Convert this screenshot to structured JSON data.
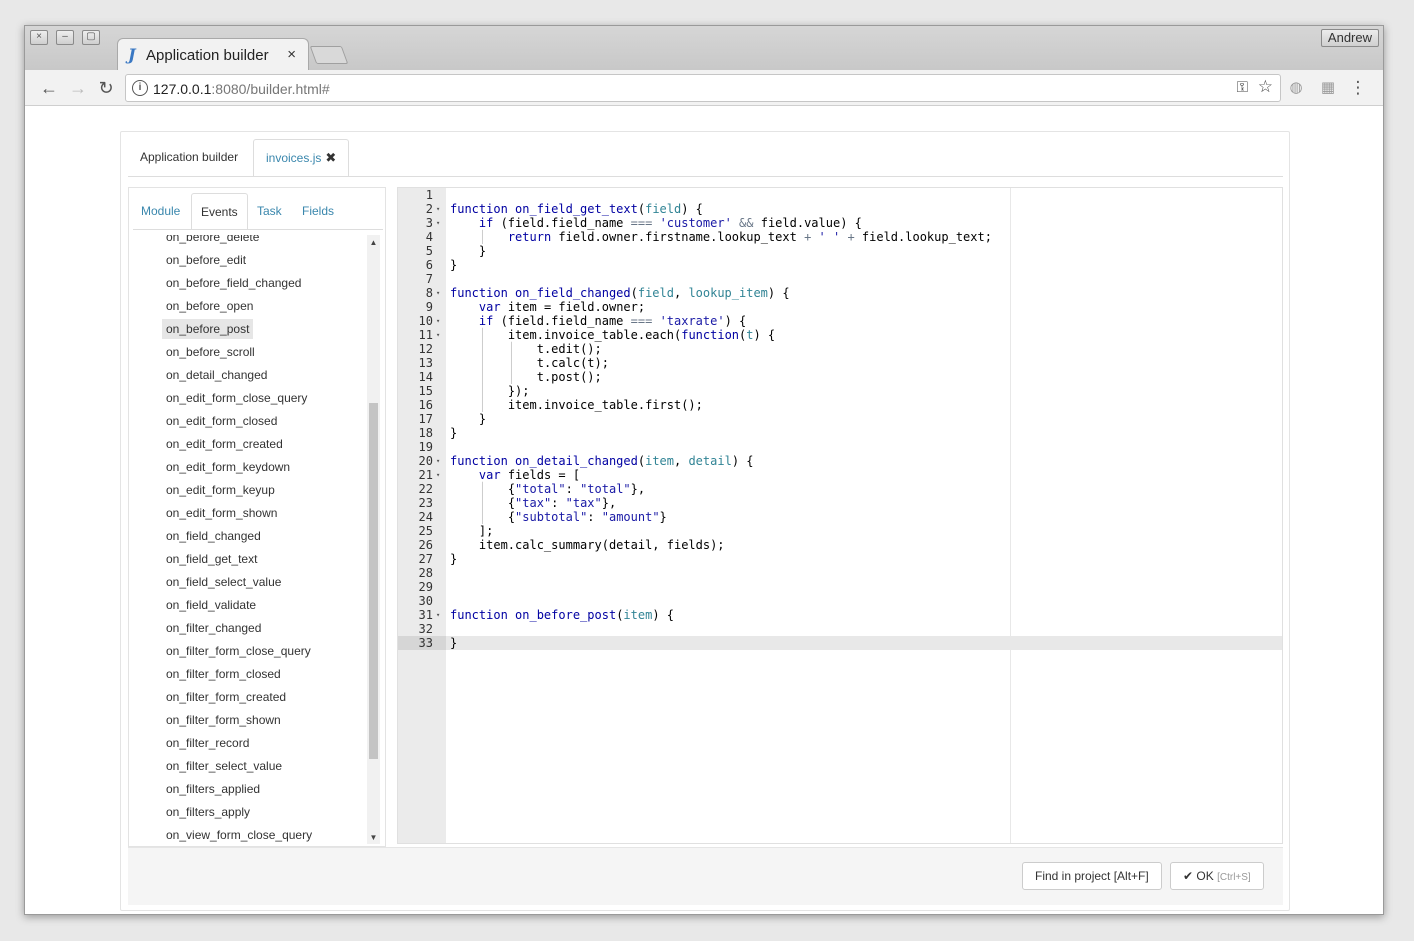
{
  "browser": {
    "tab_title": "Application builder",
    "tab_logo": "J",
    "tab_close": "×",
    "user": "Andrew",
    "window_buttons": [
      "×",
      "–",
      "▢"
    ],
    "url_host": "127.0.0.1",
    "url_rest": ":8080/builder.html#",
    "icons": {
      "back": "←",
      "forward": "→",
      "reload": "↻",
      "info": "i",
      "key": "⚿",
      "star": "☆",
      "globe": "◍",
      "ext": "▦",
      "menu": "⋮"
    }
  },
  "page_tabs": [
    {
      "label": "Application builder"
    },
    {
      "label": "invoices.js",
      "close": "✖"
    }
  ],
  "sub_tabs": [
    "Module",
    "Events",
    "Task",
    "Fields"
  ],
  "events": [
    "on_before_delete",
    "on_before_edit",
    "on_before_field_changed",
    "on_before_open",
    "on_before_post",
    "on_before_scroll",
    "on_detail_changed",
    "on_edit_form_close_query",
    "on_edit_form_closed",
    "on_edit_form_created",
    "on_edit_form_keydown",
    "on_edit_form_keyup",
    "on_edit_form_shown",
    "on_field_changed",
    "on_field_get_text",
    "on_field_select_value",
    "on_field_validate",
    "on_filter_changed",
    "on_filter_form_close_query",
    "on_filter_form_closed",
    "on_filter_form_created",
    "on_filter_form_shown",
    "on_filter_record",
    "on_filter_select_value",
    "on_filters_applied",
    "on_filters_apply",
    "on_view_form_close_query"
  ],
  "selected_event": "on_before_post",
  "scroll_arrows": {
    "up": "▲",
    "down": "▼"
  },
  "fold_marker": "▾",
  "fold_lines": [
    2,
    3,
    8,
    10,
    11,
    20,
    21,
    31
  ],
  "code_lines": [
    "",
    "function on_field_get_text(field) {",
    "    if (field.field_name === 'customer' && field.value) {",
    "        return field.owner.firstname.lookup_text + ' ' + field.lookup_text;",
    "    }",
    "}",
    "",
    "function on_field_changed(field, lookup_item) {",
    "    var item = field.owner;",
    "    if (field.field_name === 'taxrate') {",
    "        item.invoice_table.each(function(t) {",
    "            t.edit();",
    "            t.calc(t);",
    "            t.post();",
    "        });",
    "        item.invoice_table.first();",
    "    }",
    "}",
    "",
    "function on_detail_changed(item, detail) {",
    "    var fields = [",
    "        {\"total\": \"total\"},",
    "        {\"tax\": \"tax\"},",
    "        {\"subtotal\": \"amount\"}",
    "    ];",
    "    item.calc_summary(detail, fields);",
    "}",
    "",
    "",
    "",
    "function on_before_post(item) {",
    "",
    "}"
  ],
  "buttons": {
    "find": "Find in project [Alt+F]",
    "ok_icon": "✔",
    "ok": "OK",
    "ok_hint": "[Ctrl+S]"
  }
}
